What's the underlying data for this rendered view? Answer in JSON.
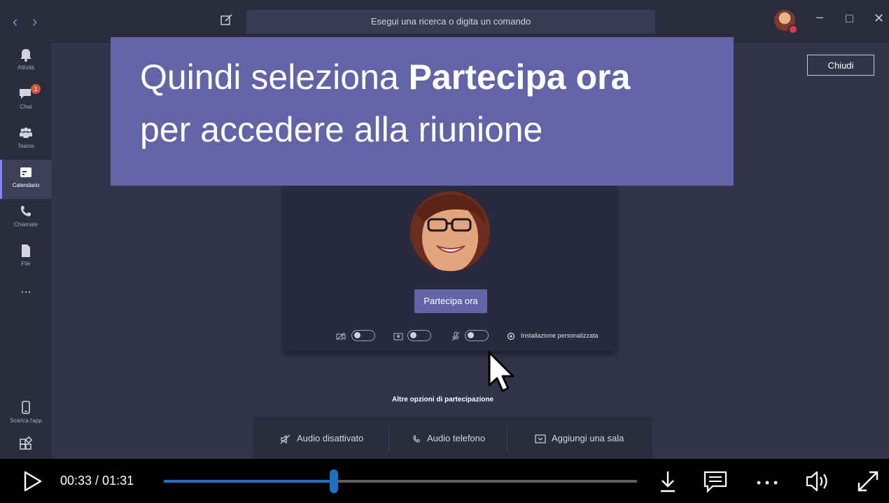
{
  "titlebar": {
    "back_icon": "chevron-left",
    "forward_icon": "chevron-right",
    "search_placeholder": "Esegui una ricerca o digita un comando",
    "window_controls": [
      "minimize",
      "maximize",
      "close"
    ]
  },
  "rail": {
    "items": [
      {
        "label": "Attività",
        "icon": "bell-icon"
      },
      {
        "label": "Chat",
        "icon": "chat-icon",
        "badge": "1"
      },
      {
        "label": "Teams",
        "icon": "teams-icon"
      },
      {
        "label": "Calendario",
        "icon": "calendar-icon",
        "active": true
      },
      {
        "label": "Chiamate",
        "icon": "phone-icon"
      },
      {
        "label": "File",
        "icon": "file-icon"
      }
    ],
    "more": "...",
    "download_label": "Scarica l'app",
    "apps_icon": "apps-icon"
  },
  "main": {
    "close_label": "Chiudi",
    "banner": {
      "line1_regular": "Quindi seleziona ",
      "line1_bold": "Partecipa ora",
      "line2": "per accedere alla riunione"
    },
    "join_button": "Partecipa ora",
    "custom_setup": "Installazione personalizzata",
    "other_options_label": "Altre opzioni di partecipazione",
    "options": [
      "Audio disattivato",
      "Audio telefono",
      "Aggiungi una sala"
    ]
  },
  "player": {
    "time": "00:33 / 01:31",
    "progress": 0.36,
    "accent": "#1e6fc6"
  },
  "colors": {
    "banner": "#6264a7",
    "rail": "#2b2c3d",
    "stage": "#33344a"
  }
}
